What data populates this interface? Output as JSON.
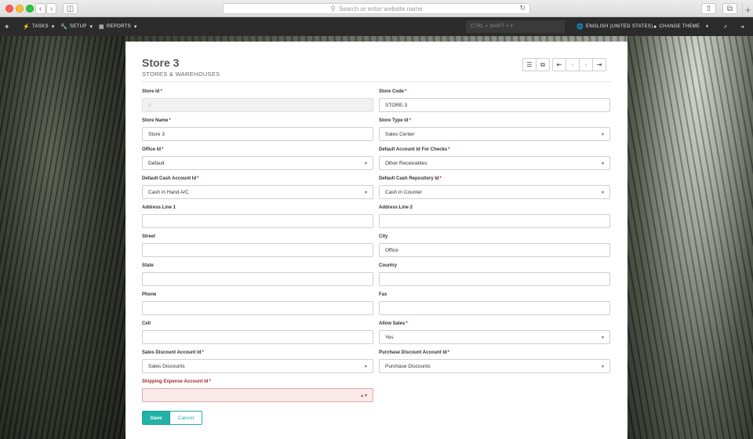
{
  "browser": {
    "url_placeholder": "Search or enter website name"
  },
  "nav": {
    "tasks": "TASKS",
    "setup": "SETUP",
    "reports": "REPORTS",
    "shortcut": "CTRL + SHIFT + F",
    "language": "ENGLISH (UNITED STATES)",
    "theme": "CHANGE THEME"
  },
  "page": {
    "title": "Store 3",
    "subtitle": "STORES & WAREHOUSES"
  },
  "form": {
    "store_id": {
      "label": "Store Id",
      "value": "5"
    },
    "store_code": {
      "label": "Store Code",
      "value": "STORE-3"
    },
    "store_name": {
      "label": "Store Name",
      "value": "Store 3"
    },
    "store_type_id": {
      "label": "Store Type Id",
      "value": "Sales Center"
    },
    "office_id": {
      "label": "Office Id",
      "value": "Default"
    },
    "default_account_checks": {
      "label": "Default Account Id For Checks",
      "value": "Other Receivables"
    },
    "default_cash_account": {
      "label": "Default Cash Account Id",
      "value": "Cash in Hand A/C"
    },
    "default_cash_repository": {
      "label": "Default Cash Repository Id",
      "value": "Cash in Counter"
    },
    "address_line_1": {
      "label": "Address Line 1",
      "value": ""
    },
    "address_line_2": {
      "label": "Address Line 2",
      "value": ""
    },
    "street": {
      "label": "Street",
      "value": ""
    },
    "city": {
      "label": "City",
      "value": "Office"
    },
    "state": {
      "label": "State",
      "value": ""
    },
    "country": {
      "label": "Country",
      "value": ""
    },
    "phone": {
      "label": "Phone",
      "value": ""
    },
    "fax": {
      "label": "Fax",
      "value": ""
    },
    "cell": {
      "label": "Cell",
      "value": ""
    },
    "allow_sales": {
      "label": "Allow Sales",
      "value": "Yes"
    },
    "sales_discount_account": {
      "label": "Sales Discount Account Id",
      "value": "Sales Discounts"
    },
    "purchase_discount_account": {
      "label": "Purchase Discount Account Id",
      "value": "Purchase Discounts"
    },
    "shipping_expense_account": {
      "label": "Shipping Expense Account Id",
      "value": ""
    }
  },
  "actions": {
    "save": "Save",
    "cancel": "Cancel"
  },
  "colors": {
    "accent": "#21b3a6",
    "required": "#c1272d",
    "nav_bg": "#2b2b2b"
  }
}
